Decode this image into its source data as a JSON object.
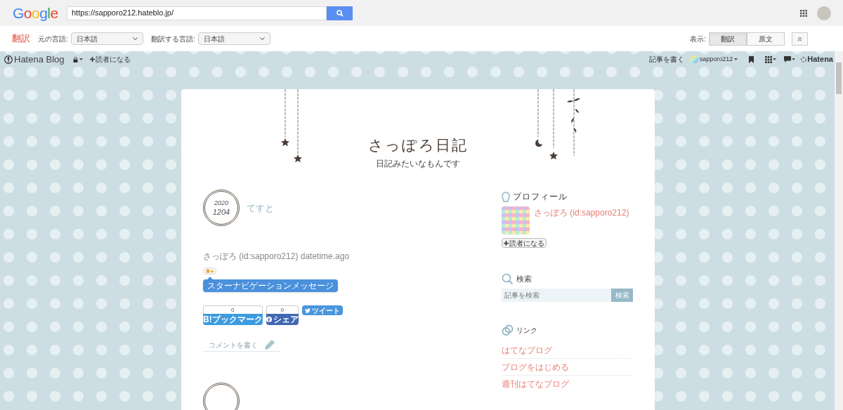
{
  "google_bar": {
    "logo": "Google",
    "url": "https://sapporo212.hateblo.jp/"
  },
  "translate_bar": {
    "title": "翻訳",
    "source_label": "元の言語:",
    "source_value": "日本語",
    "target_label": "翻訳する言語:",
    "target_value": "日本語",
    "view_label": "表示:",
    "view_options": [
      {
        "label": "翻訳",
        "selected": true
      },
      {
        "label": "原文",
        "selected": false
      }
    ]
  },
  "hatena_bar": {
    "logo": "Hatena Blog",
    "subscribe": "読者になる",
    "write": "記事を書く",
    "user": "sapporo212",
    "brand": "Hatena"
  },
  "blog": {
    "title": "さっぽろ日記",
    "description": "日記みたいなもんです"
  },
  "entry": {
    "date_year": "2020",
    "date_day": "1204",
    "title": "てすと",
    "byline": "さっぽろ (id:sapporo212) datetime.ago",
    "star_tooltip": "スターナビゲーションメッセージ",
    "shares": [
      {
        "kind": "hatena",
        "count": "0",
        "label": "B!ブックマーク"
      },
      {
        "kind": "facebook",
        "count": "0",
        "label": "シェア"
      },
      {
        "kind": "twitter",
        "label": "ツイート"
      }
    ],
    "comment": "コメントを書く"
  },
  "sidebar": {
    "profile": {
      "heading": "プロフィール",
      "name": "さっぽろ (id:sapporo212)",
      "subscribe": "読者になる"
    },
    "search": {
      "heading": "検索",
      "placeholder": "記事を検索",
      "button": "検索"
    },
    "links": {
      "heading": "リンク",
      "items": [
        "はてなブログ",
        "ブログをはじめる",
        "週刊はてなブログ"
      ]
    }
  }
}
